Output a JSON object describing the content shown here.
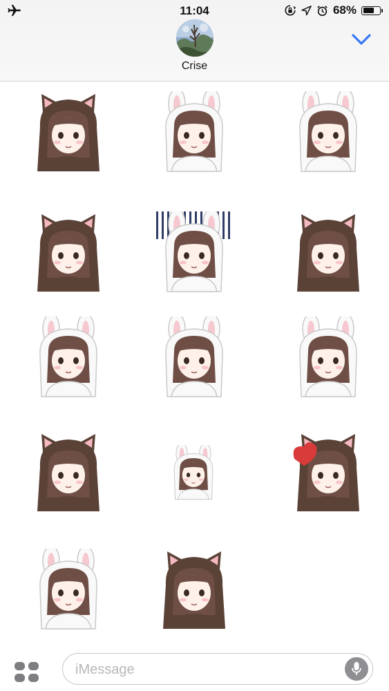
{
  "status_bar": {
    "time": "11:04",
    "battery_percent": "68%",
    "battery_level": 0.68,
    "left_icon": "airplane-icon",
    "right_icons": [
      "rotation-lock-icon",
      "location-icon",
      "alarm-icon",
      "battery-icon"
    ]
  },
  "header": {
    "contact_name": "Crise",
    "avatar": "contact-avatar",
    "collapse_icon": "chevron-down-icon",
    "accent_color": "#3478f6"
  },
  "stickers": [
    {
      "name": "sticker-cat-hood-girl-holding-paper",
      "hood": "cat"
    },
    {
      "name": "sticker-bunny-hood-girl-with-carrot",
      "hood": "bunny"
    },
    {
      "name": "sticker-bunny-hood-girl-hands-on-cheeks",
      "hood": "bunny"
    },
    {
      "name": "sticker-cat-hood-girl-shocked",
      "hood": "cat"
    },
    {
      "name": "sticker-bunny-hood-girl-gloomy",
      "hood": "bunny"
    },
    {
      "name": "sticker-cat-hood-girl-on-phone",
      "hood": "cat"
    },
    {
      "name": "sticker-bunny-hood-girl-covering-face",
      "hood": "bunny"
    },
    {
      "name": "sticker-bunny-hood-girl-crying",
      "hood": "bunny"
    },
    {
      "name": "sticker-bunny-hood-girl-brushing-teeth",
      "hood": "bunny"
    },
    {
      "name": "sticker-cat-hood-girl-brushing-teeth",
      "hood": "cat"
    },
    {
      "name": "sticker-bunny-hood-girl-tiny-jumping",
      "hood": "bunny"
    },
    {
      "name": "sticker-cat-hood-girl-thumbs-up-heart",
      "hood": "cat"
    },
    {
      "name": "sticker-bunny-hood-girl-winking-thumbs-up",
      "hood": "bunny"
    },
    {
      "name": "sticker-cat-hood-girl-winking-thumbs-up",
      "hood": "cat"
    }
  ],
  "colors": {
    "cat_hood": "#5b4237",
    "cat_ear_inner": "#f4b9c0",
    "bunny_hood": "#f9f9f9",
    "bunny_ear_inner": "#f6c8cf",
    "hair": "#6f4f45",
    "skin": "#fdf1ea",
    "blush": "#f7b8bf"
  },
  "compose": {
    "placeholder": "iMessage",
    "apps_icon": "app-drawer-icon",
    "mic_icon": "microphone-icon"
  }
}
